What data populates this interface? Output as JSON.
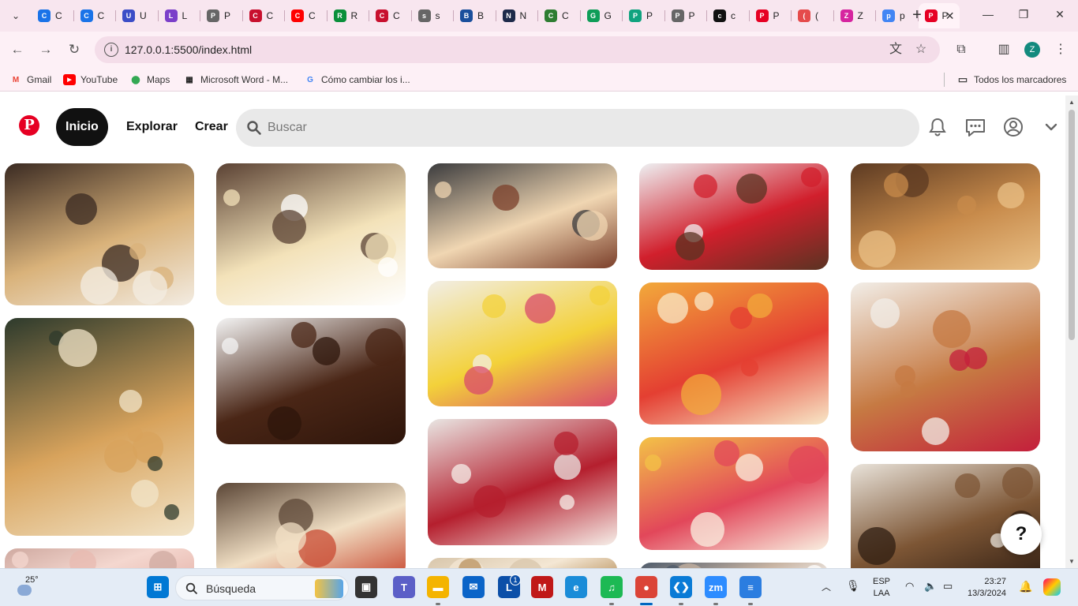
{
  "browser": {
    "tabs": [
      {
        "letter": "C",
        "color": "#1a73e8",
        "icon": "chrome-icon"
      },
      {
        "letter": "C",
        "color": "#1a73e8",
        "icon": "google-icon"
      },
      {
        "letter": "U",
        "color": "#3b4dc7",
        "icon": "u-icon"
      },
      {
        "letter": "L",
        "color": "#7b3fc9",
        "icon": "l-icon"
      },
      {
        "letter": "P",
        "color": "#666666",
        "icon": "globe-icon"
      },
      {
        "letter": "C",
        "color": "#c8102e",
        "icon": "c-icon"
      },
      {
        "letter": "C",
        "color": "#ff0000",
        "icon": "youtube-icon"
      },
      {
        "letter": "R",
        "color": "#0a8f3a",
        "icon": "r-icon"
      },
      {
        "letter": "C",
        "color": "#c8102e",
        "icon": "cherries-icon"
      },
      {
        "letter": "s",
        "color": "#666666",
        "icon": "globe-icon"
      },
      {
        "letter": "B",
        "color": "#1a4f9c",
        "icon": "b-icon"
      },
      {
        "letter": "N",
        "color": "#1e2a4a",
        "icon": "n-icon"
      },
      {
        "letter": "C",
        "color": "#2e7d32",
        "icon": "c-icon"
      },
      {
        "letter": "G",
        "color": "#0f9d58",
        "icon": "sheets-icon"
      },
      {
        "letter": "P",
        "color": "#10a37f",
        "icon": "openai-icon"
      },
      {
        "letter": "P",
        "color": "#666666",
        "icon": "globe-icon"
      },
      {
        "letter": "c",
        "color": "#111111",
        "icon": "github-icon"
      },
      {
        "letter": "P",
        "color": "#e60023",
        "icon": "pinterest-icon"
      },
      {
        "letter": "(",
        "color": "#e54b4b",
        "icon": "notification-icon"
      },
      {
        "letter": "Z",
        "color": "#d6249f",
        "icon": "instagram-icon"
      },
      {
        "letter": "p",
        "color": "#4285f4",
        "icon": "google-icon"
      },
      {
        "letter": "P",
        "color": "#e60023",
        "icon": "pinterest-icon",
        "active": true
      }
    ],
    "url": "127.0.0.1:5500/index.html",
    "profile_initial": "Z",
    "bookmarks": [
      {
        "label": "Gmail",
        "icon": "gmail-icon"
      },
      {
        "label": "YouTube",
        "icon": "youtube-icon"
      },
      {
        "label": "Maps",
        "icon": "maps-icon"
      },
      {
        "label": "Microsoft Word - M...",
        "icon": "word-icon"
      },
      {
        "label": "Cómo cambiar los i...",
        "icon": "google-icon"
      }
    ],
    "all_bookmarks": "Todos los marcadores"
  },
  "pinterest": {
    "logo": "P",
    "nav": {
      "home": "Inicio",
      "explore": "Explorar",
      "create": "Crear"
    },
    "search_placeholder": "Buscar",
    "help": "?"
  },
  "pins": [
    {
      "name": "pin-mini-tarts",
      "colors": [
        "#3a2a22",
        "#d9b27a",
        "#f3ece2"
      ]
    },
    {
      "name": "pin-lemon-meringue-tarts",
      "colors": [
        "#2d3a2c",
        "#d8a35c",
        "#f2e4c8"
      ]
    },
    {
      "name": "pin-pink-dessert",
      "colors": [
        "#cfa9a0",
        "#f4d7cf",
        "#e8b9b0"
      ]
    },
    {
      "name": "pin-coconut-cake",
      "colors": [
        "#5a4133",
        "#f3e2b9",
        "#ffffff"
      ]
    },
    {
      "name": "pin-chocolate-dessert",
      "colors": [
        "#f4f4f4",
        "#4a2616",
        "#2e150b"
      ]
    },
    {
      "name": "pin-layered-pastries",
      "colors": [
        "#5b4636",
        "#f1dfc4",
        "#c84a32"
      ]
    },
    {
      "name": "pin-cake-display",
      "colors": [
        "#3b3b3d",
        "#f0d6b2",
        "#7b3f2a"
      ]
    },
    {
      "name": "pin-lemon-cakes",
      "colors": [
        "#f2eee6",
        "#f3d13a",
        "#d94b6b"
      ]
    },
    {
      "name": "pin-red-velvet-cake",
      "colors": [
        "#e9e6e3",
        "#b51f2e",
        "#f6efe9"
      ]
    },
    {
      "name": "pin-bakery-treats",
      "colors": [
        "#d8c6ab",
        "#f4e7d4",
        "#b9925f"
      ]
    },
    {
      "name": "pin-cake-slices",
      "colors": [
        "#eef0f2",
        "#d11f2c",
        "#5a3322"
      ]
    },
    {
      "name": "pin-fruit-tarts-buffet",
      "colors": [
        "#f2a93b",
        "#e43f32",
        "#f8e8c8"
      ]
    },
    {
      "name": "pin-colorful-pastries",
      "colors": [
        "#f3c247",
        "#e2475a",
        "#f9efe0"
      ]
    },
    {
      "name": "pin-dessert-bottom",
      "colors": [
        "#4d5a6a",
        "#c7b3a2",
        "#ffffff"
      ]
    },
    {
      "name": "pin-croissants-pastries",
      "colors": [
        "#5c3a22",
        "#c88b4b",
        "#e9c087"
      ]
    },
    {
      "name": "pin-donuts",
      "colors": [
        "#f2eee8",
        "#c67a43",
        "#c41f3b"
      ]
    },
    {
      "name": "pin-cookies-donuts-brownies",
      "colors": [
        "#e9e3da",
        "#7d5635",
        "#2f1d12"
      ]
    }
  ],
  "taskbar": {
    "temperature": "25°",
    "search_placeholder": "Búsqueda",
    "language_line1": "ESP",
    "language_line2": "LAA",
    "time": "23:27",
    "date": "13/3/2024",
    "apps": [
      {
        "name": "start",
        "label": "⊞",
        "color": "#0078d4"
      },
      {
        "name": "task-view",
        "label": "▣",
        "color": "#333333"
      },
      {
        "name": "teams",
        "label": "T",
        "color": "#5b5fc7"
      },
      {
        "name": "file-explorer",
        "label": "▬",
        "color": "#f4b400"
      },
      {
        "name": "mail",
        "label": "✉",
        "color": "#0a64c8"
      },
      {
        "name": "launcher",
        "label": "L",
        "color": "#0b4fa8"
      },
      {
        "name": "mcafee",
        "label": "M",
        "color": "#c01818"
      },
      {
        "name": "edge",
        "label": "e",
        "color": "#1a8cd8"
      },
      {
        "name": "spotify",
        "label": "♫",
        "color": "#1db954"
      },
      {
        "name": "chrome",
        "label": "●",
        "color": "#db4437"
      },
      {
        "name": "vscode",
        "label": "❮❯",
        "color": "#0a7bd6"
      },
      {
        "name": "zoom",
        "label": "zm",
        "color": "#2d8cff"
      },
      {
        "name": "notepad",
        "label": "≡",
        "color": "#2b7de0"
      }
    ],
    "badge_count": "1"
  }
}
